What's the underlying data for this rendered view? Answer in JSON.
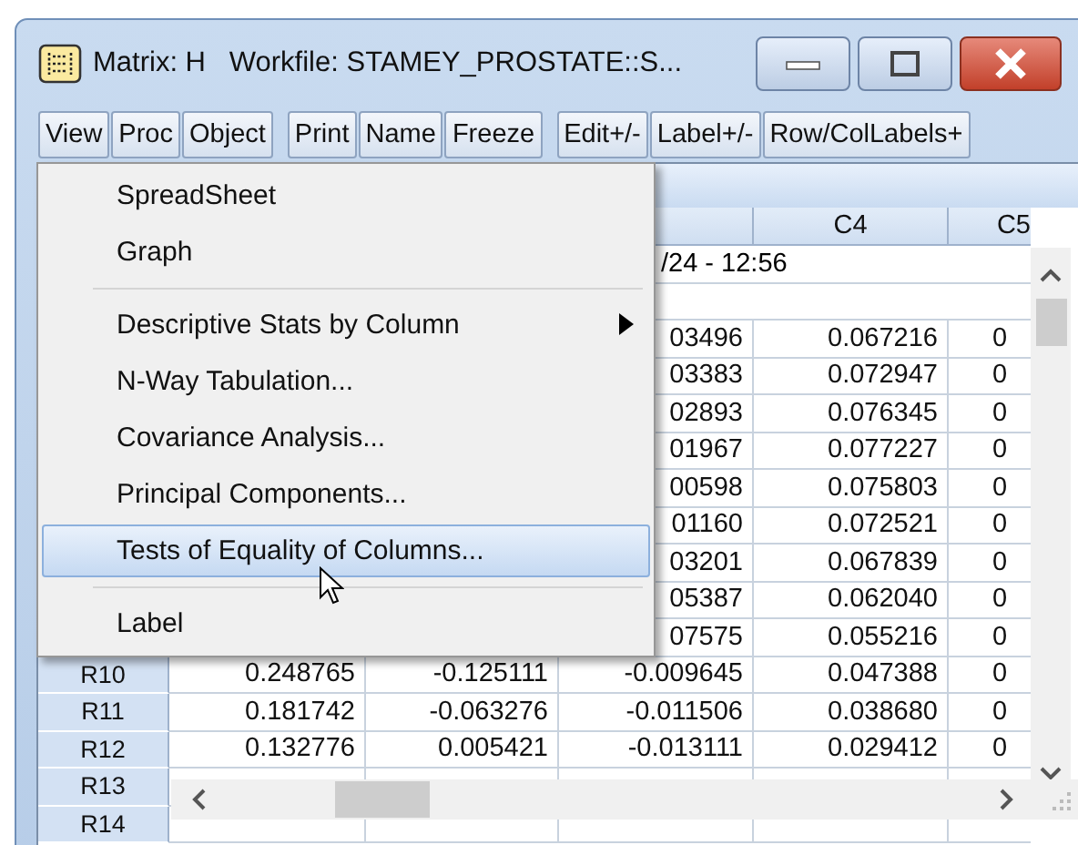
{
  "window": {
    "title": "Matrix: H   Workfile: STAMEY_PROSTATE::S..."
  },
  "toolbar": [
    {
      "label": "View"
    },
    {
      "label": "Proc"
    },
    {
      "label": "Object"
    },
    {
      "label": "Print"
    },
    {
      "label": "Name"
    },
    {
      "label": "Freeze"
    },
    {
      "label": "Edit+/-"
    },
    {
      "label": "Label+/-"
    },
    {
      "label": "Row/ColLabels+"
    }
  ],
  "menu": {
    "items": [
      {
        "kind": "item",
        "label": "SpreadSheet",
        "selected": false
      },
      {
        "kind": "item",
        "label": "Graph",
        "selected": false
      },
      {
        "kind": "separator"
      },
      {
        "kind": "submenu",
        "label": "Descriptive Stats by Column",
        "selected": false
      },
      {
        "kind": "item",
        "label": "N-Way Tabulation...",
        "selected": false
      },
      {
        "kind": "item",
        "label": "Covariance Analysis...",
        "selected": false
      },
      {
        "kind": "item",
        "label": "Principal Components...",
        "selected": false
      },
      {
        "kind": "item",
        "label": "Tests of Equality of Columns...",
        "selected": true
      },
      {
        "kind": "separator"
      },
      {
        "kind": "item",
        "label": "Label",
        "selected": false
      }
    ]
  },
  "table": {
    "column_headers": [
      "C4",
      "C5"
    ],
    "note": "/24 - 12:56",
    "rows": [
      {
        "cells": [
          "03496",
          "0.067216",
          "0"
        ]
      },
      {
        "cells": [
          "03383",
          "0.072947",
          "0"
        ]
      },
      {
        "cells": [
          "02893",
          "0.076345",
          "0"
        ]
      },
      {
        "cells": [
          "01967",
          "0.077227",
          "0"
        ]
      },
      {
        "cells": [
          "00598",
          "0.075803",
          "0"
        ]
      },
      {
        "cells": [
          "01160",
          "0.072521",
          "0"
        ]
      },
      {
        "cells": [
          "03201",
          "0.067839",
          "0"
        ]
      },
      {
        "cells": [
          "05387",
          "0.062040",
          "0"
        ]
      },
      {
        "cells": [
          "07575",
          "0.055216",
          "0"
        ]
      },
      {
        "label": "R10",
        "cells": [
          "0.248765",
          "-0.125111",
          "-0.009645",
          "0.047388",
          "0"
        ]
      },
      {
        "label": "R11",
        "cells": [
          "0.181742",
          "-0.063276",
          "-0.011506",
          "0.038680",
          "0"
        ]
      },
      {
        "label": "R12",
        "cells": [
          "0.132776",
          "0.005421",
          "-0.013111",
          "0.029412",
          "0"
        ]
      },
      {
        "label": "R13"
      },
      {
        "label": "R14"
      }
    ]
  }
}
